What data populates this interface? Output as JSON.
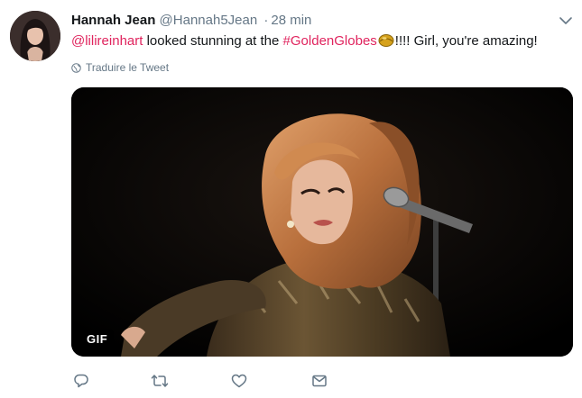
{
  "tweet": {
    "author_name": "Hannah Jean",
    "handle": "@Hannah5Jean",
    "separator": "·",
    "timestamp": "28 min",
    "text": {
      "mention": "@lilireinhart",
      "part1": " looked stunning at the ",
      "hashtag": "#GoldenGlobes",
      "part2": "!!!! Girl, you're amazing!"
    },
    "translate_label": "Traduire le Tweet",
    "media": {
      "badge": "GIF"
    },
    "actions": [
      "reply-icon",
      "retweet-icon",
      "like-icon",
      "direct-message-icon"
    ]
  },
  "colors": {
    "link": "#e0245e",
    "secondary_text": "#657786",
    "icon": "#657786"
  }
}
